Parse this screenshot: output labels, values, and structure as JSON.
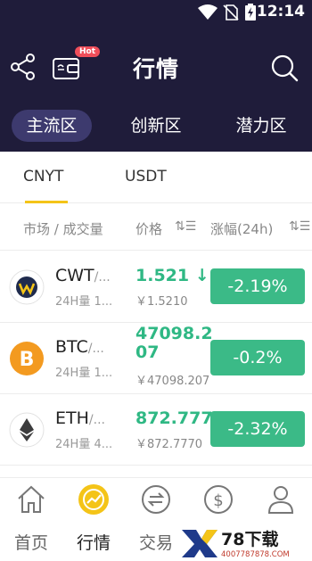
{
  "status_bar": {
    "time": "12:14"
  },
  "header": {
    "title": "行情",
    "hot_badge": "Hot",
    "zones": [
      "主流区",
      "创新区",
      "潜力区"
    ],
    "active_zone": 0
  },
  "currency_tabs": [
    "CNYT",
    "USDT"
  ],
  "columns": {
    "market": "市场 / 成交量",
    "price": "价格",
    "change": "涨幅(24h)",
    "sort_icon": "⇅☰"
  },
  "rows": [
    {
      "symbol": "CWT",
      "slash": "/...",
      "volume": "24H量 1...",
      "price": "1.521",
      "price_arrow": "↓",
      "price_cny": "￥1.5210",
      "change": "-2.19%",
      "icon": "cwt-logo-icon"
    },
    {
      "symbol": "BTC",
      "slash": "/...",
      "volume": "24H量 1...",
      "price_line1": "47098.2",
      "price_line2": "07",
      "price_cny": "￥47098.207",
      "change": "-0.2%",
      "icon": "bitcoin-logo-icon"
    },
    {
      "symbol": "ETH",
      "slash": "/...",
      "volume": "24H量 4...",
      "price": "872.777",
      "price_cny": "￥872.7770",
      "change": "-2.32%",
      "icon": "ethereum-logo-icon"
    }
  ],
  "tabbar": {
    "items": [
      "首页",
      "行情",
      "交易",
      "",
      ""
    ],
    "active": 1
  },
  "watermark": {
    "big": "78下载",
    "small": "4007787878.COM"
  },
  "colors": {
    "header_bg": "#1f1c3a",
    "up_green": "#2fb884",
    "change_bg": "#3bba87",
    "accent_yellow": "#f4c418"
  }
}
